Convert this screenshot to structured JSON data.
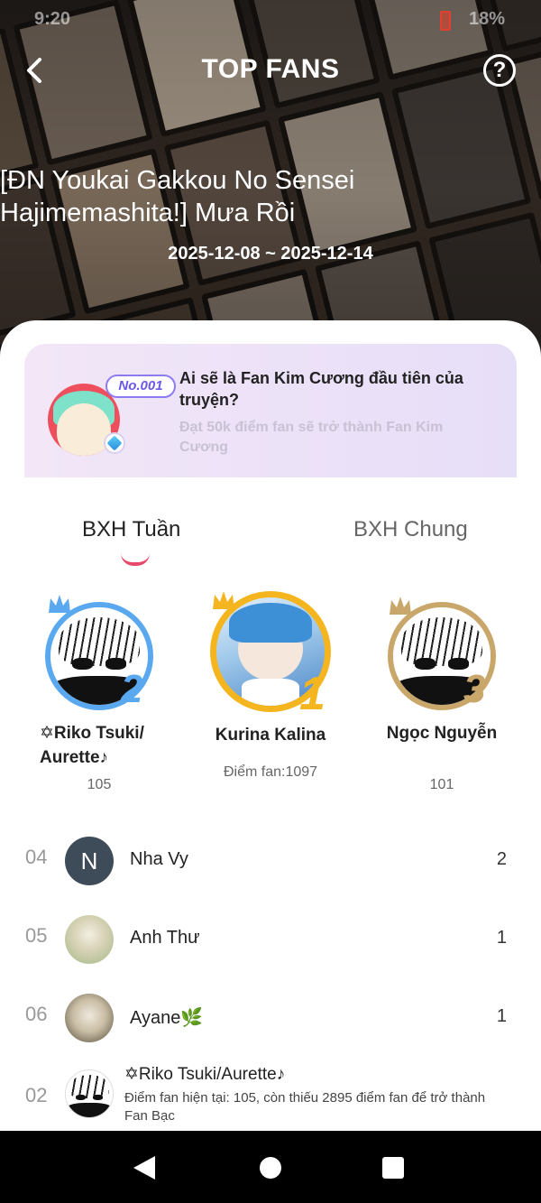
{
  "status_bar": {
    "time": "9:20",
    "battery": "18%"
  },
  "header": {
    "title": "TOP FANS",
    "story_title": "[ĐN Youkai Gakkou No Sensei Hajimemashita!] Mưa Rồi",
    "date_range": "2025-12-08 ~ 2025-12-14",
    "help_glyph": "?"
  },
  "promo": {
    "badge": "No.001",
    "title": "Ai sẽ là Fan Kim Cương đầu tiên của truyện?",
    "subtitle": "Đạt 50k điểm fan sẽ trở thành Fan Kim Cương"
  },
  "tabs": {
    "weekly": "BXH Tuần",
    "overall": "BXH Chung",
    "active": "weekly"
  },
  "podium": [
    {
      "rank": "2",
      "name": "✡Riko Tsuki/ Aurette♪",
      "score": "105",
      "ring_color": "#5aa8ef"
    },
    {
      "rank": "1",
      "name": "Kurina Kalina",
      "score": "Điểm fan:1097",
      "ring_color": "#f5b51e"
    },
    {
      "rank": "3",
      "name": "Ngọc Nguyễn",
      "score": "101",
      "ring_color": "#c9a76b"
    }
  ],
  "list": [
    {
      "rank": "04",
      "name": "Nha Vy",
      "score": "2",
      "avatar_letter": "N"
    },
    {
      "rank": "05",
      "name": "Anh Thư",
      "score": "1"
    },
    {
      "rank": "06",
      "name": "Ayane🌿",
      "score": "1"
    }
  ],
  "me": {
    "rank": "02",
    "name": "✡Riko Tsuki/Aurette♪",
    "note": "Điểm fan hiện tại: 105, còn thiếu 2895 điểm fan để trở thành Fan Bạc"
  }
}
